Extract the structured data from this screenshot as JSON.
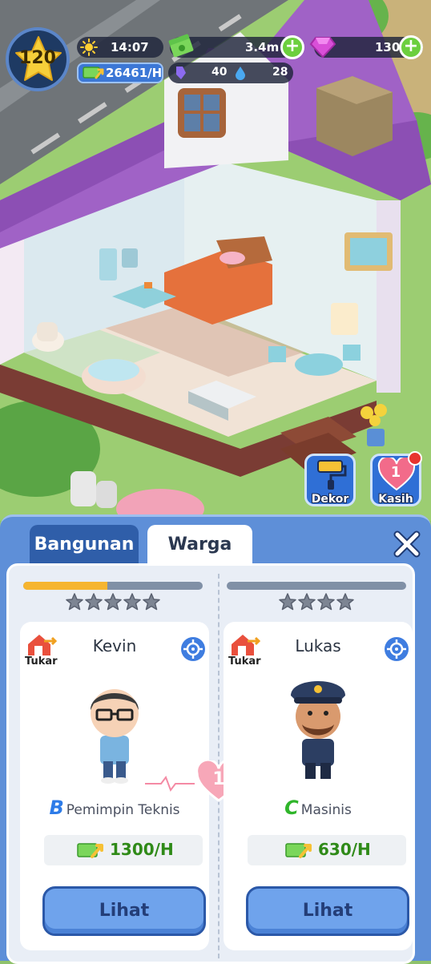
{
  "hud": {
    "level": "120",
    "time": "14:07",
    "cash": "3.4m",
    "gems": "130",
    "income": "26461/H",
    "energy": "40",
    "water": "28"
  },
  "side_buttons": {
    "decor_label": "Dekor",
    "love_label": "Kasih",
    "love_count": "1"
  },
  "panel": {
    "tabs": [
      {
        "label": "Bangunan",
        "active": false
      },
      {
        "label": "Warga",
        "active": true
      }
    ],
    "love_level": "1",
    "residents": [
      {
        "name": "Kevin",
        "swap_label": "Tukar",
        "stars": 5,
        "progress": 0.47,
        "grade": "B",
        "grade_color": "#2d7be8",
        "role": "Pemimpin Teknis",
        "income": "1300/H",
        "view_label": "Lihat"
      },
      {
        "name": "Lukas",
        "swap_label": "Tukar",
        "stars": 4,
        "progress": 0,
        "grade": "C",
        "grade_color": "#2fb52a",
        "role": "Masinis",
        "income": "630/H",
        "view_label": "Lihat"
      }
    ]
  },
  "colors": {
    "panel": "#5e8fd8",
    "roof": "#a062c6",
    "income_green": "#2f8a18",
    "progress_fill": "#f6b530"
  }
}
